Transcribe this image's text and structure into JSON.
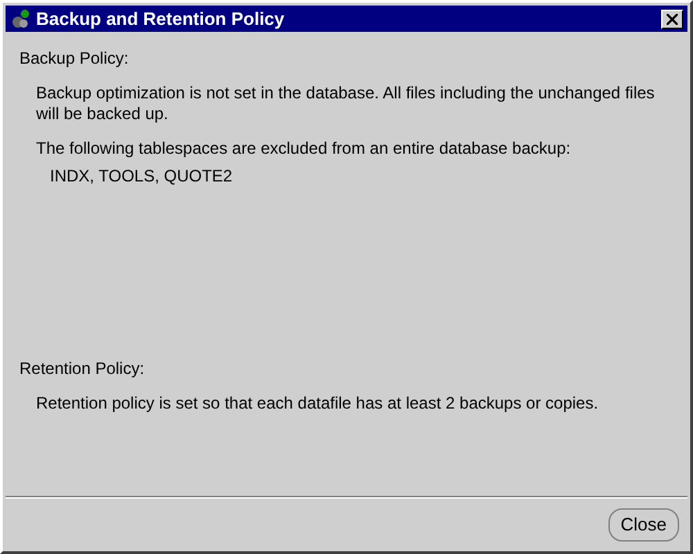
{
  "window": {
    "title": "Backup and Retention Policy"
  },
  "backup_policy": {
    "heading": "Backup Policy:",
    "paragraphs": [
      "Backup optimization is not set in the database.  All files including the unchanged files will be backed up.",
      "The following tablespaces are excluded from an entire database backup:"
    ],
    "excluded": "INDX, TOOLS, QUOTE2"
  },
  "retention_policy": {
    "heading": "Retention Policy:",
    "text": "Retention policy is set so that each datafile has at least 2 backups or copies."
  },
  "buttons": [
    "Close"
  ]
}
